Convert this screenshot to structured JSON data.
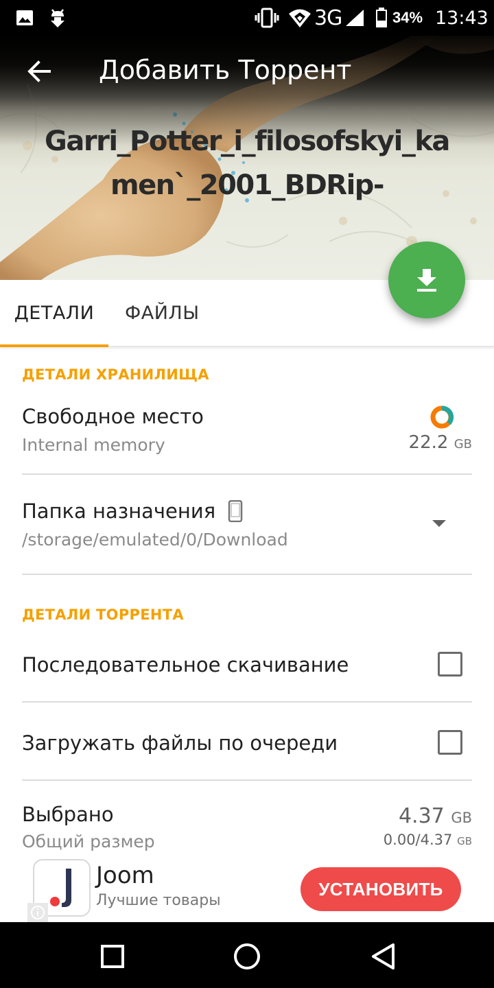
{
  "status_bar": {
    "network": "3G",
    "battery": "34%",
    "time": "13:43",
    "icons": [
      "gallery-icon",
      "android-debug-icon",
      "vibrate-icon",
      "wifi-icon",
      "signal-icon",
      "battery-icon"
    ]
  },
  "appbar": {
    "title": "Добавить Торрент",
    "back_icon": "arrow-back-icon"
  },
  "torrent": {
    "name": "Garri_Potter_i_filosofskyi_kamen`_2001_BDRip-"
  },
  "fab": {
    "icon": "download-icon",
    "color": "#4caf50"
  },
  "tabs": [
    {
      "label": "ДЕТАЛИ",
      "active": true
    },
    {
      "label": "ФАЙЛЫ",
      "active": false
    }
  ],
  "storage": {
    "header": "ДЕТАЛИ ХРАНИЛИЩА",
    "free_space": {
      "title": "Свободное место",
      "subtitle": "Internal memory",
      "value": "22.2",
      "unit": "GB"
    },
    "destination": {
      "title": "Папка назначения",
      "path": "/storage/emulated/0/Download"
    }
  },
  "torrent_details": {
    "header": "ДЕТАЛИ ТОРРЕНТА",
    "sequential": {
      "label": "Последовательное скачивание",
      "checked": false
    },
    "queue": {
      "label": "Загружать файлы по очереди",
      "checked": false
    },
    "selected": {
      "title": "Выбрано",
      "subtitle": "Общий размер",
      "value": "4.37",
      "unit": "GB",
      "progress_value": "0.00/4.37",
      "progress_unit": "GB"
    }
  },
  "ad": {
    "title": "Joom",
    "subtitle": "Лучшие товары",
    "install_label": "УСТАНОВИТЬ"
  },
  "colors": {
    "accent": "#f5a000",
    "fab": "#4caf50",
    "install": "#ef4b4b"
  }
}
